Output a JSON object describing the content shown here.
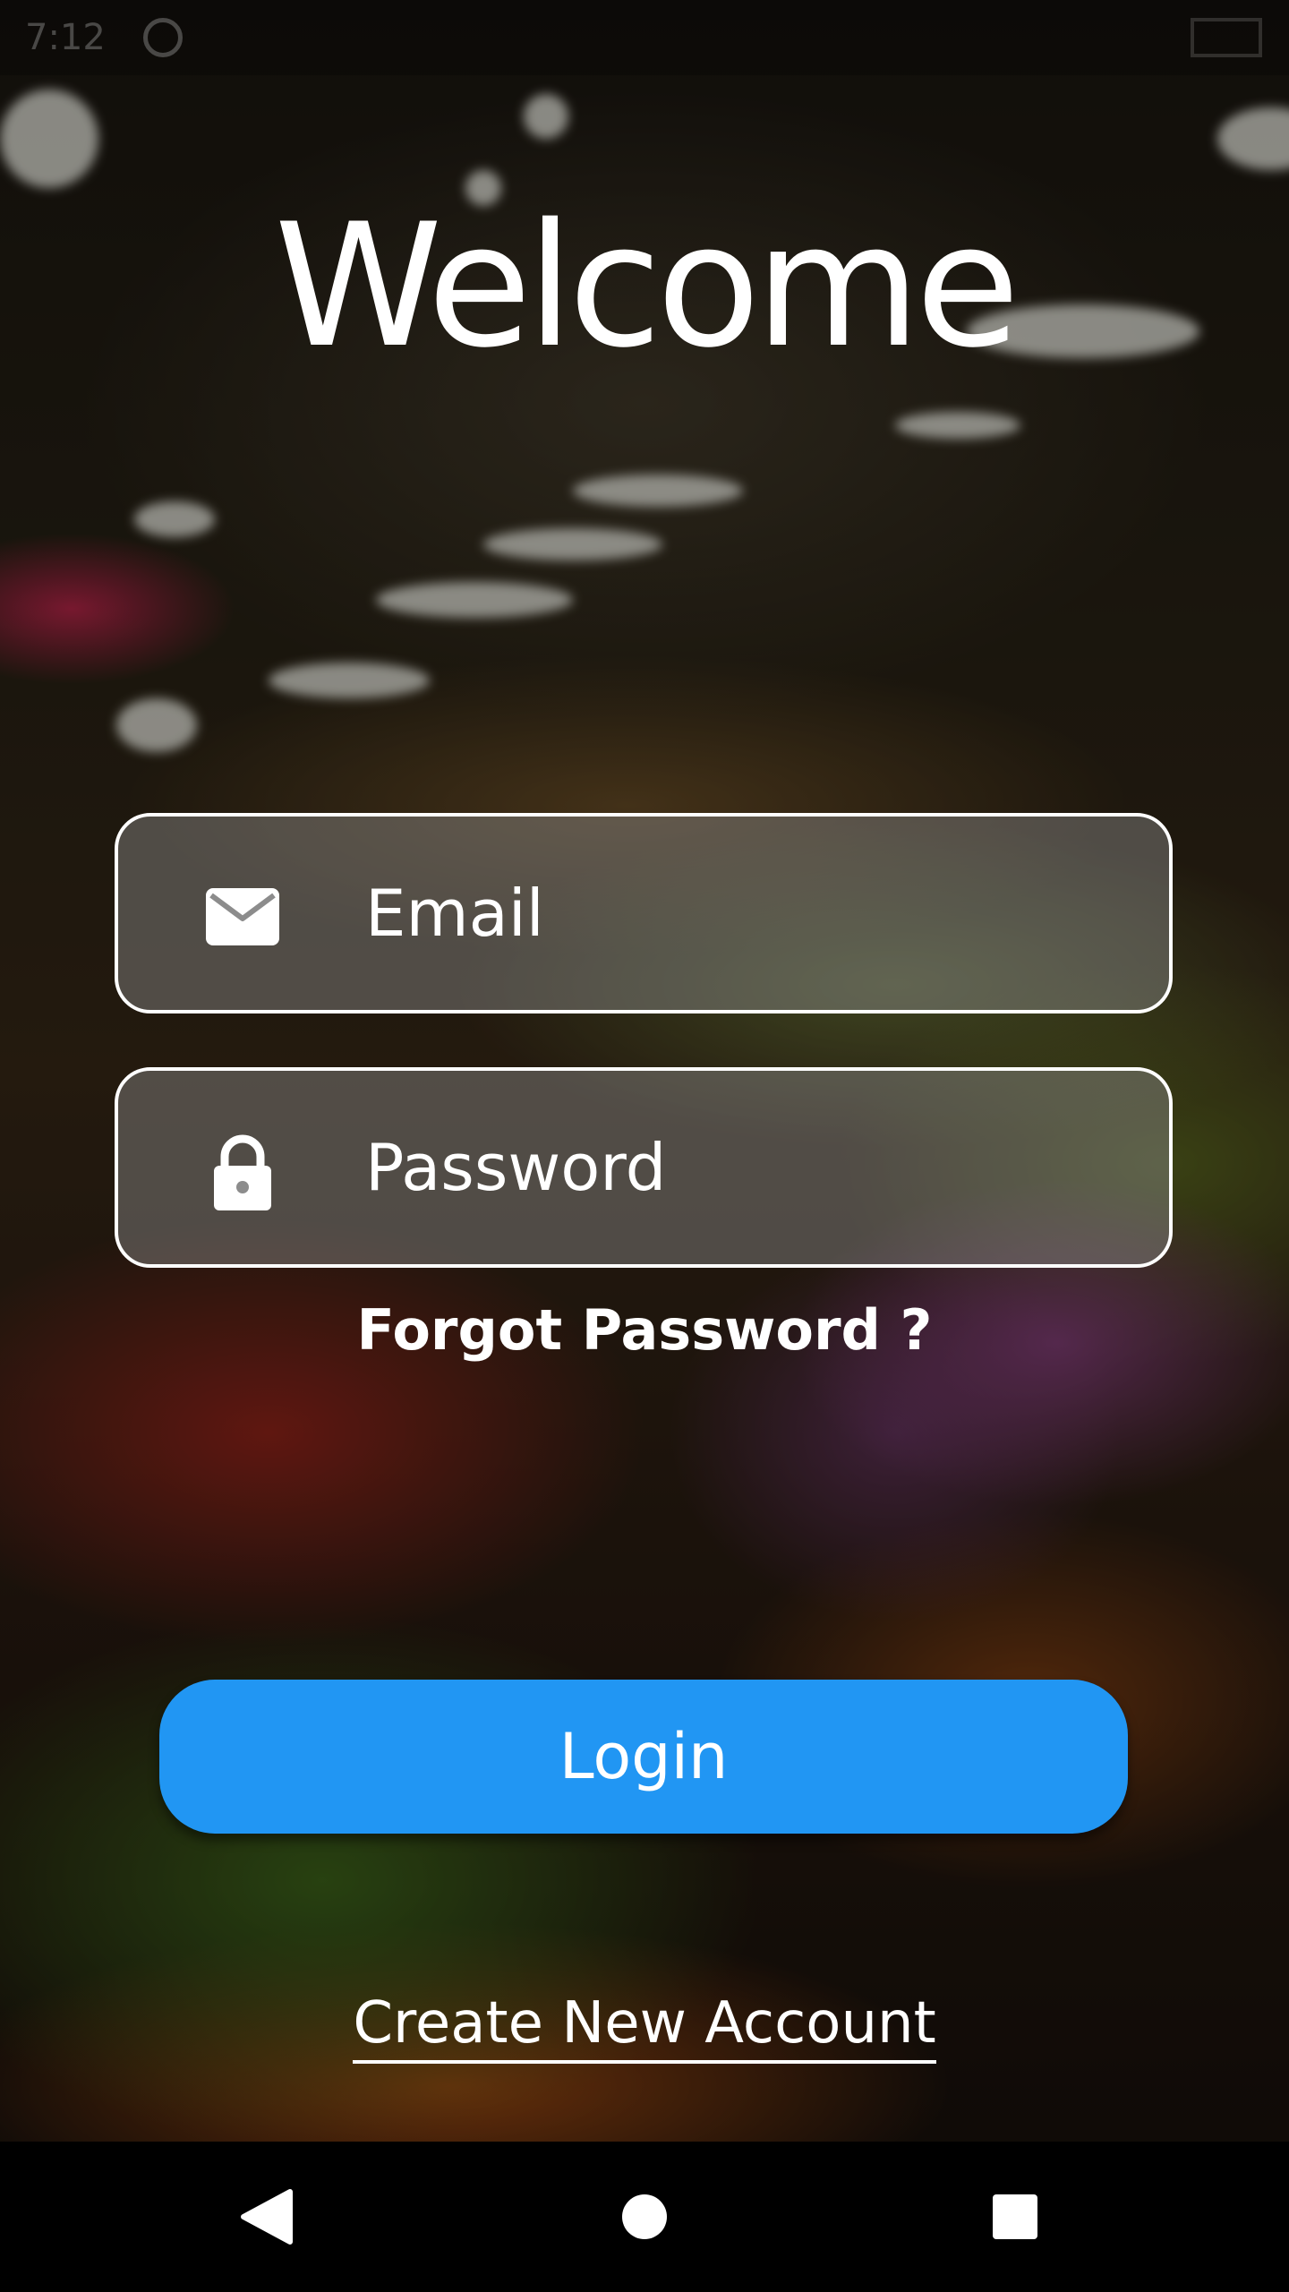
{
  "status_bar": {
    "time": "7:12",
    "notification_icon": "notification-icon",
    "battery_icon": "battery-icon"
  },
  "title": "Welcome",
  "form": {
    "email": {
      "icon": "envelope-icon",
      "placeholder": "Email",
      "value": ""
    },
    "password": {
      "icon": "lock-icon",
      "placeholder": "Password",
      "value": ""
    },
    "forgot_label": "Forgot Password ?",
    "login_label": "Login",
    "create_account_label": "Create New Account"
  },
  "colors": {
    "primary_button": "#2196f3",
    "text": "#ffffff",
    "nav_bar": "#000000"
  },
  "nav_bar": {
    "back_icon": "back-triangle-icon",
    "home_icon": "home-circle-icon",
    "recents_icon": "recents-square-icon"
  }
}
